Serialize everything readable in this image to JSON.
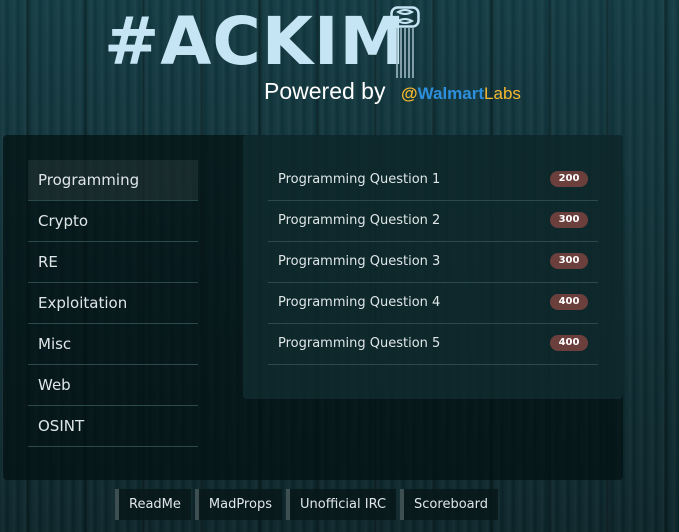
{
  "header": {
    "title": "#ACKIM",
    "powered_by": "Powered by",
    "brand_at": "@",
    "brand_name": "Walmart",
    "brand_suffix": "Labs",
    "colors": {
      "title": "#c5e4f4",
      "brand_blue": "#2d8fdc",
      "brand_yellow": "#f5b82e"
    }
  },
  "categories": [
    {
      "label": "Programming",
      "active": true
    },
    {
      "label": "Crypto",
      "active": false
    },
    {
      "label": "RE",
      "active": false
    },
    {
      "label": "Exploitation",
      "active": false
    },
    {
      "label": "Misc",
      "active": false
    },
    {
      "label": "Web",
      "active": false
    },
    {
      "label": "OSINT",
      "active": false
    }
  ],
  "questions": [
    {
      "title": "Programming Question 1",
      "points": "200"
    },
    {
      "title": "Programming Question 2",
      "points": "300"
    },
    {
      "title": "Programming Question 3",
      "points": "300"
    },
    {
      "title": "Programming Question 4",
      "points": "400"
    },
    {
      "title": "Programming Question 5",
      "points": "400"
    }
  ],
  "footer_nav": [
    "ReadMe",
    "MadProps",
    "Unofficial IRC",
    "Scoreboard"
  ],
  "icons": {
    "logo_chip": "chip-8-icon"
  }
}
